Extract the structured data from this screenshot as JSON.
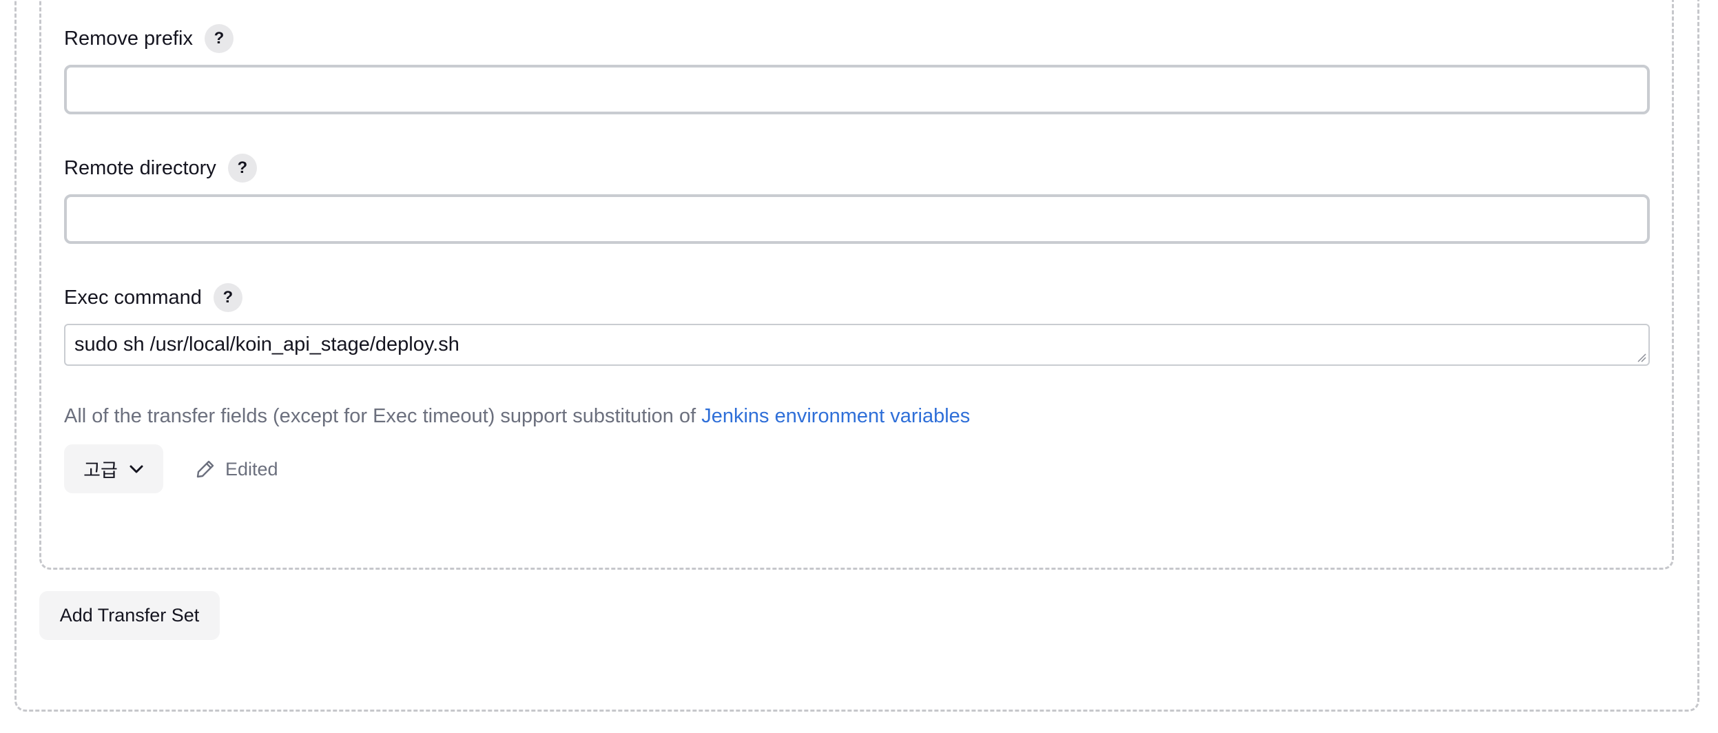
{
  "fields": {
    "remove_prefix": {
      "label": "Remove prefix",
      "help": "?",
      "value": ""
    },
    "remote_directory": {
      "label": "Remote directory",
      "help": "?",
      "value": ""
    },
    "exec_command": {
      "label": "Exec command",
      "help": "?",
      "value": "sudo sh /usr/local/koin_api_stage/deploy.sh"
    }
  },
  "info": {
    "text": "All of the transfer fields (except for Exec timeout) support substitution of ",
    "link_text": "Jenkins environment variables"
  },
  "advanced": {
    "label": "고급",
    "icon": "chevron-down-icon"
  },
  "edited": {
    "label": "Edited",
    "icon": "pencil-icon"
  },
  "add_transfer_set": {
    "label": "Add Transfer Set"
  },
  "colors": {
    "link": "#2f6fd8",
    "muted_text": "#6b6f7d",
    "button_bg": "#f4f4f5",
    "border": "#c9ccd1"
  }
}
